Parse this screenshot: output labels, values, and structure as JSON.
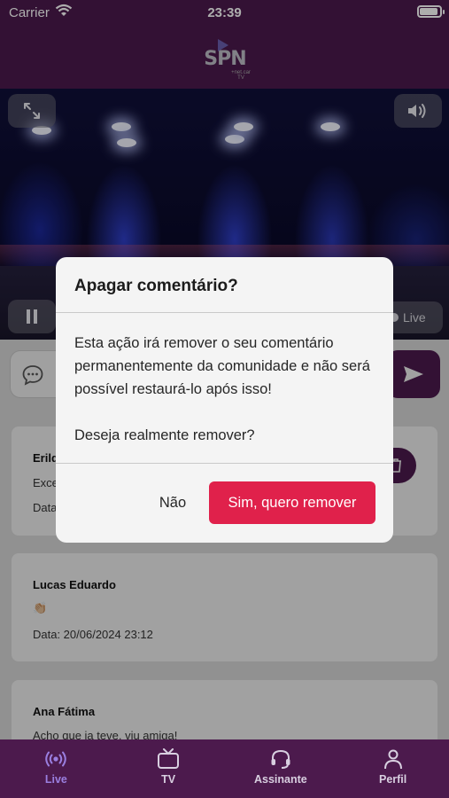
{
  "status_bar": {
    "carrier": "Carrier",
    "time": "23:39"
  },
  "header": {
    "logo_text": "SPN",
    "logo_sub": "+net.car TV"
  },
  "player": {
    "live_label": "Live"
  },
  "comment_input": {
    "placeholder": ""
  },
  "comments": [
    {
      "author": "Erild",
      "text": "Exce",
      "date": "Data"
    },
    {
      "author": "Lucas Eduardo",
      "text": "👏🏼",
      "date": "Data: 20/06/2024 23:12"
    },
    {
      "author": "Ana Fátima",
      "text": "Acho que ja teve, viu amiga!",
      "date": ""
    }
  ],
  "modal": {
    "title": "Apagar comentário?",
    "body_line1": "Esta ação irá remover o seu comentário permanentemente da comunidade e não será possível restaurá-lo após isso!",
    "body_line2": "Deseja realmente remover?",
    "cancel_label": "Não",
    "confirm_label": "Sim, quero remover"
  },
  "tab_bar": {
    "items": [
      {
        "label": "Live",
        "icon": "broadcast-icon",
        "active": true
      },
      {
        "label": "TV",
        "icon": "tv-icon",
        "active": false
      },
      {
        "label": "Assinante",
        "icon": "headset-icon",
        "active": false
      },
      {
        "label": "Perfil",
        "icon": "person-icon",
        "active": false
      }
    ]
  },
  "colors": {
    "brand": "#4c1a4d",
    "accent": "#e0214b",
    "active_tab": "#9a7fe0"
  }
}
